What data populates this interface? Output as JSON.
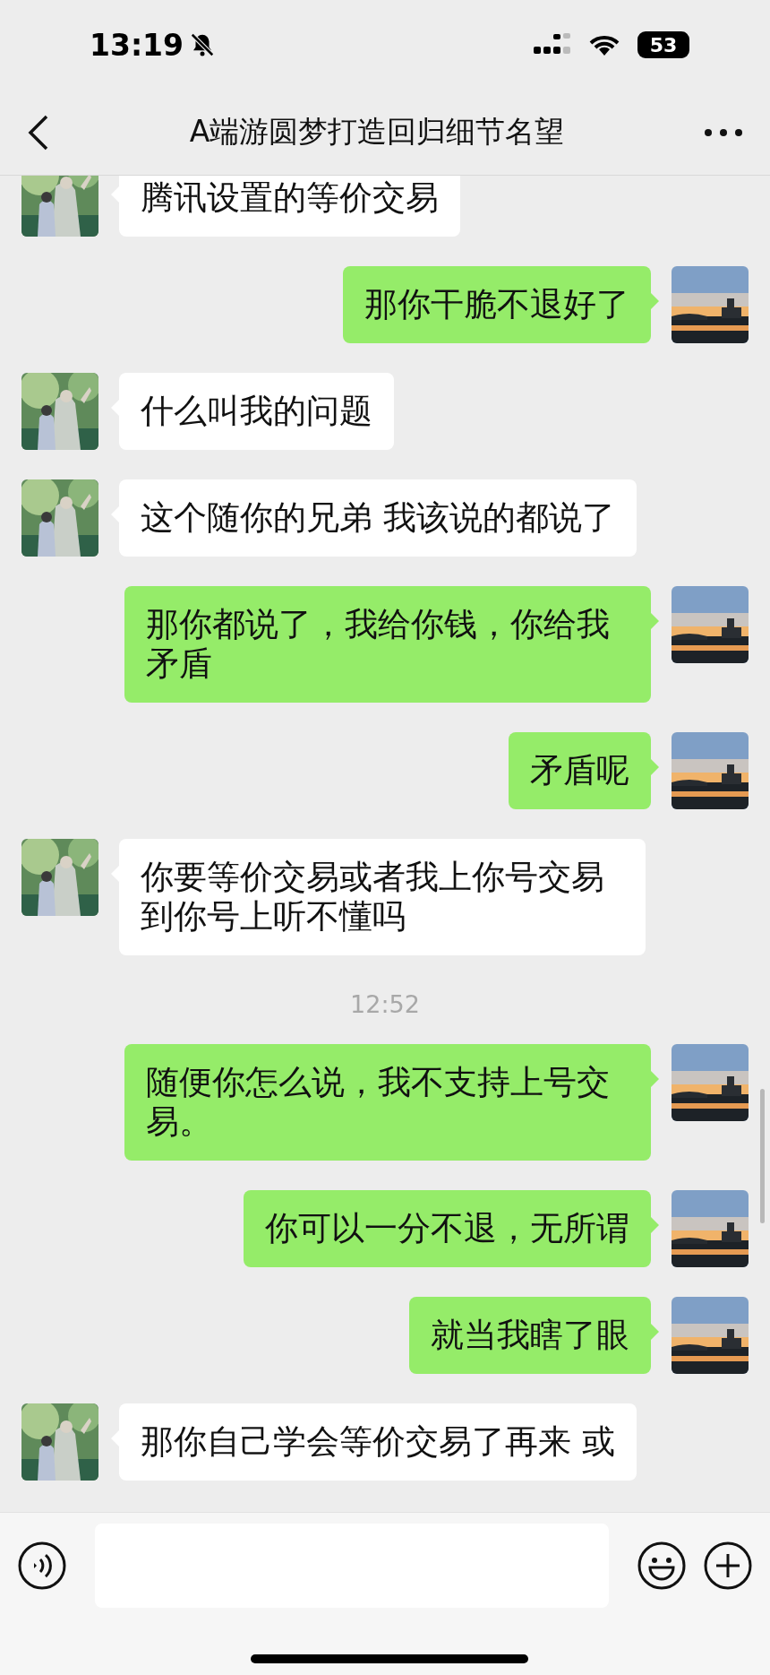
{
  "status_bar": {
    "time": "13:19",
    "silent": true,
    "battery": "53"
  },
  "header": {
    "title": "A端游圆梦打造回归细节名望"
  },
  "messages": [
    {
      "kind": "message",
      "outgoing": false,
      "text": "腾讯设置的等价交易"
    },
    {
      "kind": "message",
      "outgoing": true,
      "text": "那你干脆不退好了"
    },
    {
      "kind": "message",
      "outgoing": false,
      "text": "什么叫我的问题"
    },
    {
      "kind": "message",
      "outgoing": false,
      "text": "这个随你的兄弟 我该说的都说了"
    },
    {
      "kind": "message",
      "outgoing": true,
      "text": "那你都说了，我给你钱，你给我矛盾"
    },
    {
      "kind": "message",
      "outgoing": true,
      "text": "矛盾呢"
    },
    {
      "kind": "message",
      "outgoing": false,
      "text": "你要等价交易或者我上你号交易到你号上听不懂吗"
    },
    {
      "kind": "timestamp",
      "text": "12:52"
    },
    {
      "kind": "message",
      "outgoing": true,
      "text": "随便你怎么说，我不支持上号交易。"
    },
    {
      "kind": "message",
      "outgoing": true,
      "text": "你可以一分不退，无所谓"
    },
    {
      "kind": "message",
      "outgoing": true,
      "text": "就当我瞎了眼"
    },
    {
      "kind": "message",
      "outgoing": false,
      "text": "那你自己学会等价交易了再来 或"
    }
  ]
}
